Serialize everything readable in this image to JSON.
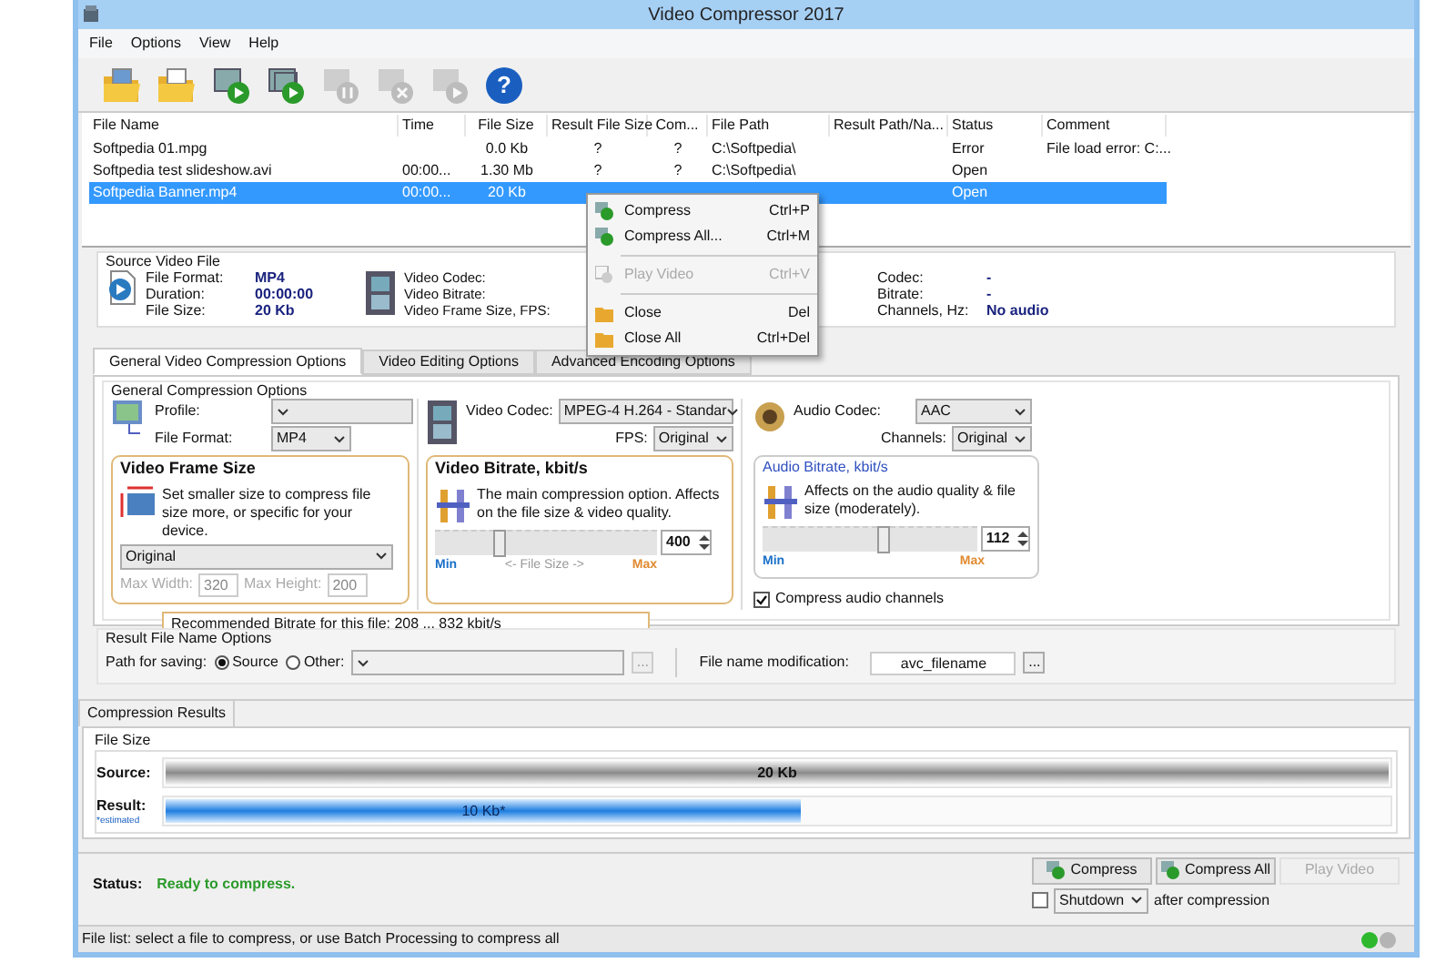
{
  "window": {
    "title": "Video Compressor 2017"
  },
  "menu": [
    {
      "label": "File"
    },
    {
      "label": "Options"
    },
    {
      "label": "View"
    },
    {
      "label": "Help"
    }
  ],
  "toolbar": [
    {
      "kind": "open-file",
      "disabled": false
    },
    {
      "kind": "open-folder",
      "disabled": false
    },
    {
      "kind": "compress",
      "disabled": false
    },
    {
      "kind": "compress-all",
      "disabled": false
    },
    {
      "kind": "pause",
      "disabled": true
    },
    {
      "kind": "stop",
      "disabled": true
    },
    {
      "kind": "play",
      "disabled": true
    },
    {
      "kind": "help",
      "label": "?",
      "disabled": false
    }
  ],
  "file_list": {
    "columns": [
      "File Name",
      "Time",
      "File Size",
      "Result File Size",
      "Com...",
      "File Path",
      "Result Path/Na...",
      "Status",
      "Comment"
    ],
    "rows": [
      {
        "cells": [
          "Softpedia 01.mpg",
          null,
          "0.0 Kb",
          "?",
          "?",
          "C:\\Softpedia\\",
          null,
          "Error",
          "File load error: C:..."
        ],
        "selected": false
      },
      {
        "cells": [
          "Softpedia test slideshow.avi",
          "00:00...",
          "1.30 Mb",
          "?",
          "?",
          "C:\\Softpedia\\",
          null,
          "Open",
          null
        ],
        "selected": false
      },
      {
        "cells": [
          "Softpedia Banner.mp4",
          "00:00...",
          "20 Kb",
          null,
          null,
          null,
          null,
          "Open",
          null
        ],
        "selected": true
      }
    ]
  },
  "context_menu": [
    {
      "kind": "compress",
      "label": "Compress",
      "shortcut": "Ctrl+P",
      "disabled": false,
      "separator_before": false
    },
    {
      "kind": "compress",
      "label": "Compress All...",
      "shortcut": "Ctrl+M",
      "disabled": false,
      "separator_before": false
    },
    {
      "kind": "play",
      "label": "Play Video",
      "shortcut": "Ctrl+V",
      "disabled": true,
      "separator_before": true
    },
    {
      "kind": "close",
      "label": "Close",
      "shortcut": "Del",
      "disabled": false,
      "separator_before": true
    },
    {
      "kind": "close",
      "label": "Close All",
      "shortcut": "Ctrl+Del",
      "disabled": false,
      "separator_before": false
    }
  ],
  "source_video": {
    "title": "Source Video File",
    "general": [
      {
        "label": "File Format:",
        "value": "MP4"
      },
      {
        "label": "Duration:",
        "value": "00:00:00"
      },
      {
        "label": "File Size:",
        "value": "20 Kb"
      }
    ],
    "video": [
      {
        "label": "Video Codec:"
      },
      {
        "label": "Video Bitrate:"
      },
      {
        "label": "Video Frame Size, FPS:"
      }
    ],
    "audio": [
      {
        "label": "Codec:",
        "value": "-"
      },
      {
        "label": "Bitrate:",
        "value": "-"
      },
      {
        "label": "Channels, Hz:",
        "value": "No audio"
      }
    ]
  },
  "tabs": [
    {
      "label": "General Video Compression Options",
      "selected": true
    },
    {
      "label": "Video Editing Options",
      "selected": false
    },
    {
      "label": "Advanced Encoding Options",
      "selected": false
    }
  ],
  "general": {
    "title": "General Compression Options",
    "profile": {
      "label": "Profile:"
    },
    "file_format": {
      "label": "File Format:",
      "value": "MP4"
    },
    "frame_size": {
      "title": "Video Frame Size",
      "description": "Set smaller size to compress file size more, or specific for your device.",
      "preset": "Original",
      "max_width": {
        "label": "Max Width:",
        "value": "320",
        "disabled": true
      },
      "max_height": {
        "label": "Max Height:",
        "value": "200",
        "disabled": true
      }
    },
    "video_codec": {
      "label": "Video Codec:",
      "value": "MPEG-4 H.264 - Standar"
    },
    "fps": {
      "label": "FPS:",
      "value": "Original"
    },
    "video_bitrate": {
      "title": "Video Bitrate, kbit/s",
      "description": "The main compression option. Affects on the file size & video quality.",
      "level": 0.29,
      "value": "400",
      "min": "Min",
      "max": "Max",
      "axis": "<- File Size ->"
    },
    "recommended": "Recommended Bitrate for this file: 208 ... 832 kbit/s",
    "audio_codec": {
      "label": "Audio Codec:",
      "value": "AAC"
    },
    "channels": {
      "label": "Channels:",
      "value": "Original"
    },
    "audio_bitrate": {
      "title": "Audio Bitrate, kbit/s",
      "description": "Affects on the audio quality & file size (moderately).",
      "level": 0.56,
      "value": "112",
      "min": "Min",
      "max": "Max"
    },
    "compress_audio": {
      "label": "Compress audio channels",
      "checked": true
    }
  },
  "result_name": {
    "title": "Result File Name Options",
    "path_label": "Path for saving:",
    "options": [
      {
        "label": "Source",
        "selected": true
      },
      {
        "label": "Other:",
        "selected": false
      }
    ],
    "browse": "...",
    "modification": {
      "label": "File name modification:",
      "value": "avc_filename",
      "browse": "..."
    }
  },
  "results": {
    "tab": "Compression Results",
    "title": "File Size",
    "bars": [
      {
        "label": "Source:",
        "value": "20 Kb",
        "level": 1
      },
      {
        "label": "Result:",
        "note": "*estimated",
        "value": "10 Kb*",
        "level": 0.52
      }
    ]
  },
  "status": {
    "label": "Status:",
    "value": "Ready to compress."
  },
  "buttons": [
    {
      "kind": "compress",
      "label": "Compress",
      "disabled": false
    },
    {
      "kind": "compress",
      "label": "Compress All",
      "disabled": false
    },
    {
      "kind": "plain",
      "label": "Play Video",
      "disabled": true
    }
  ],
  "shutdown": {
    "checked": false,
    "value": "Shutdown",
    "suffix": "after compression"
  },
  "status_bar": {
    "text": "File list: select a file to compress, or use Batch Processing to compress all",
    "lights": [
      {
        "color": "#2db82d"
      },
      {
        "color": "#b4b4b4"
      }
    ]
  }
}
